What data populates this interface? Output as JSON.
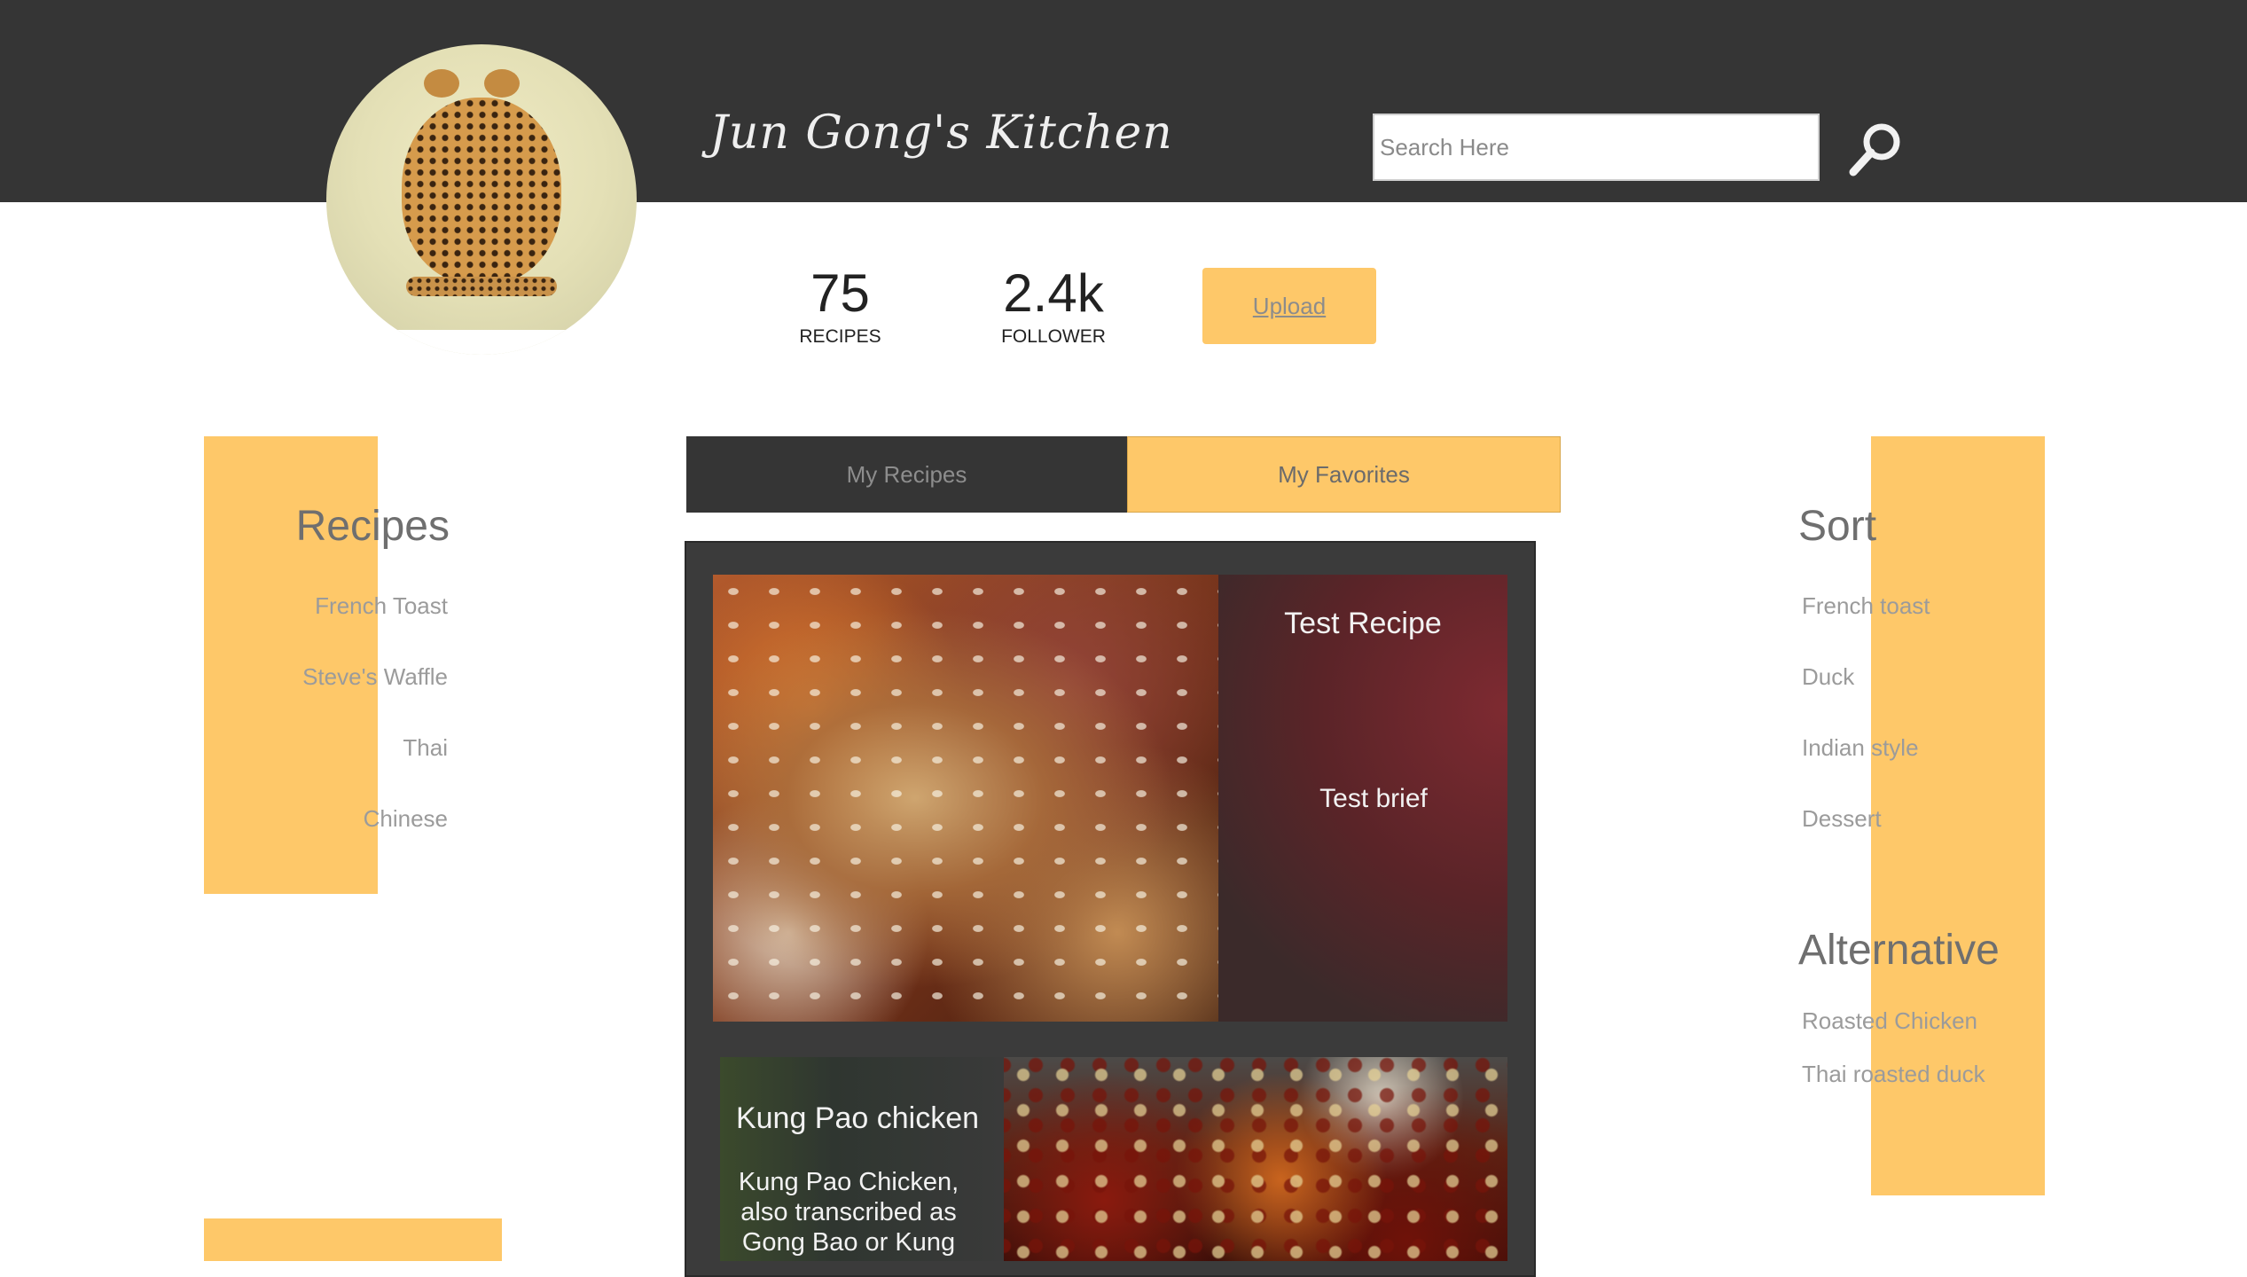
{
  "header": {
    "title": "Jun Gong's Kitchen",
    "search_placeholder": "Search Here",
    "search_icon": "magnifier-icon"
  },
  "profile": {
    "avatar_icon": "cheetah-avatar",
    "stats": [
      {
        "value": "75",
        "label": "RECIPES"
      },
      {
        "value": "2.4k",
        "label": "FOLLOWER"
      }
    ],
    "upload_label": "Upload"
  },
  "left_sidebar": {
    "heading": "Recipes",
    "items": [
      "French Toast",
      "Steve's Waffle",
      "Thai",
      "Chinese"
    ]
  },
  "tabs": [
    {
      "label": "My Recipes",
      "active": false
    },
    {
      "label": "My Favorites",
      "active": true
    }
  ],
  "cards": [
    {
      "title": "Test Recipe",
      "brief": "Test brief"
    },
    {
      "title": "Kung Pao chicken",
      "brief": "Kung Pao Chicken, also transcribed as Gong Bao or Kung"
    }
  ],
  "right_sidebar": {
    "sort_heading": "Sort",
    "sort_items": [
      "French toast",
      "Duck",
      "Indian style",
      "Dessert"
    ],
    "alt_heading": "Alternative",
    "alt_items": [
      "Roasted Chicken",
      "Thai roasted duck"
    ]
  },
  "colors": {
    "header_bg": "#353535",
    "accent": "#fec869",
    "text_muted": "#9b9b9b"
  }
}
